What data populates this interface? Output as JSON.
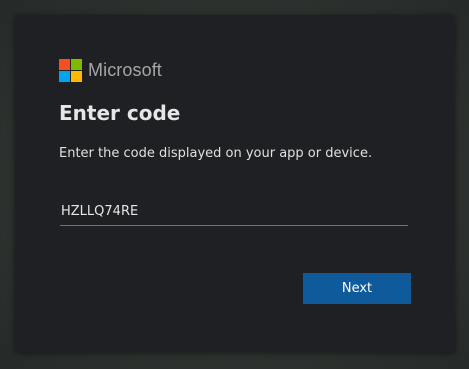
{
  "brand": {
    "name": "Microsoft",
    "logo_colors": [
      "#f25022",
      "#7fba00",
      "#00a4ef",
      "#ffb900"
    ]
  },
  "dialog": {
    "title": "Enter code",
    "subtitle": "Enter the code displayed on your app or device.",
    "code_value": "HZLLQ74RE",
    "next_label": "Next"
  },
  "colors": {
    "accent": "#0e5a9a",
    "input_underline": "#2f7fd0",
    "card_background": "#1f2023"
  }
}
